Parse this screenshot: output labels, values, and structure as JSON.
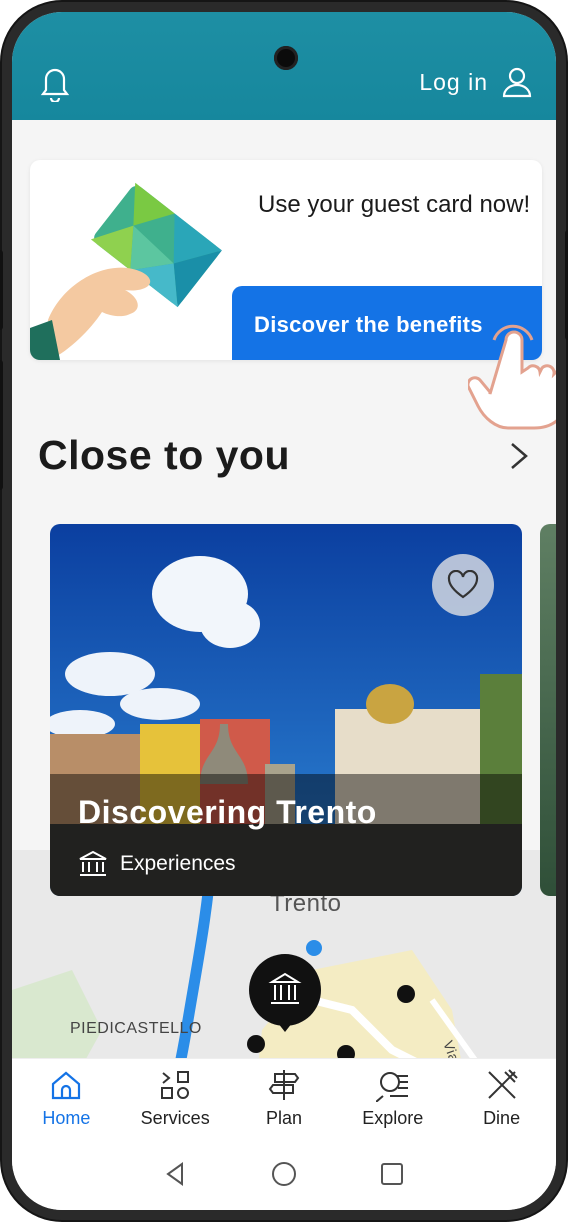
{
  "header": {
    "login_label": "Log in"
  },
  "banner": {
    "text": "Use your guest card now!",
    "button_label": "Discover the benefits"
  },
  "section": {
    "title": "Close to you"
  },
  "card": {
    "title": "Discovering Trento",
    "category": "Experiences"
  },
  "map": {
    "labels": [
      "Trento",
      "PIEDICASTELLO",
      "Via V"
    ]
  },
  "bottom_nav": {
    "items": [
      {
        "label": "Home",
        "icon": "home-icon",
        "active": true
      },
      {
        "label": "Services",
        "icon": "services-icon",
        "active": false
      },
      {
        "label": "Plan",
        "icon": "signpost-icon",
        "active": false
      },
      {
        "label": "Explore",
        "icon": "explore-icon",
        "active": false
      },
      {
        "label": "Dine",
        "icon": "fork-knife-icon",
        "active": false
      }
    ]
  },
  "colors": {
    "header": "#16879d",
    "accent": "#1473e6"
  }
}
